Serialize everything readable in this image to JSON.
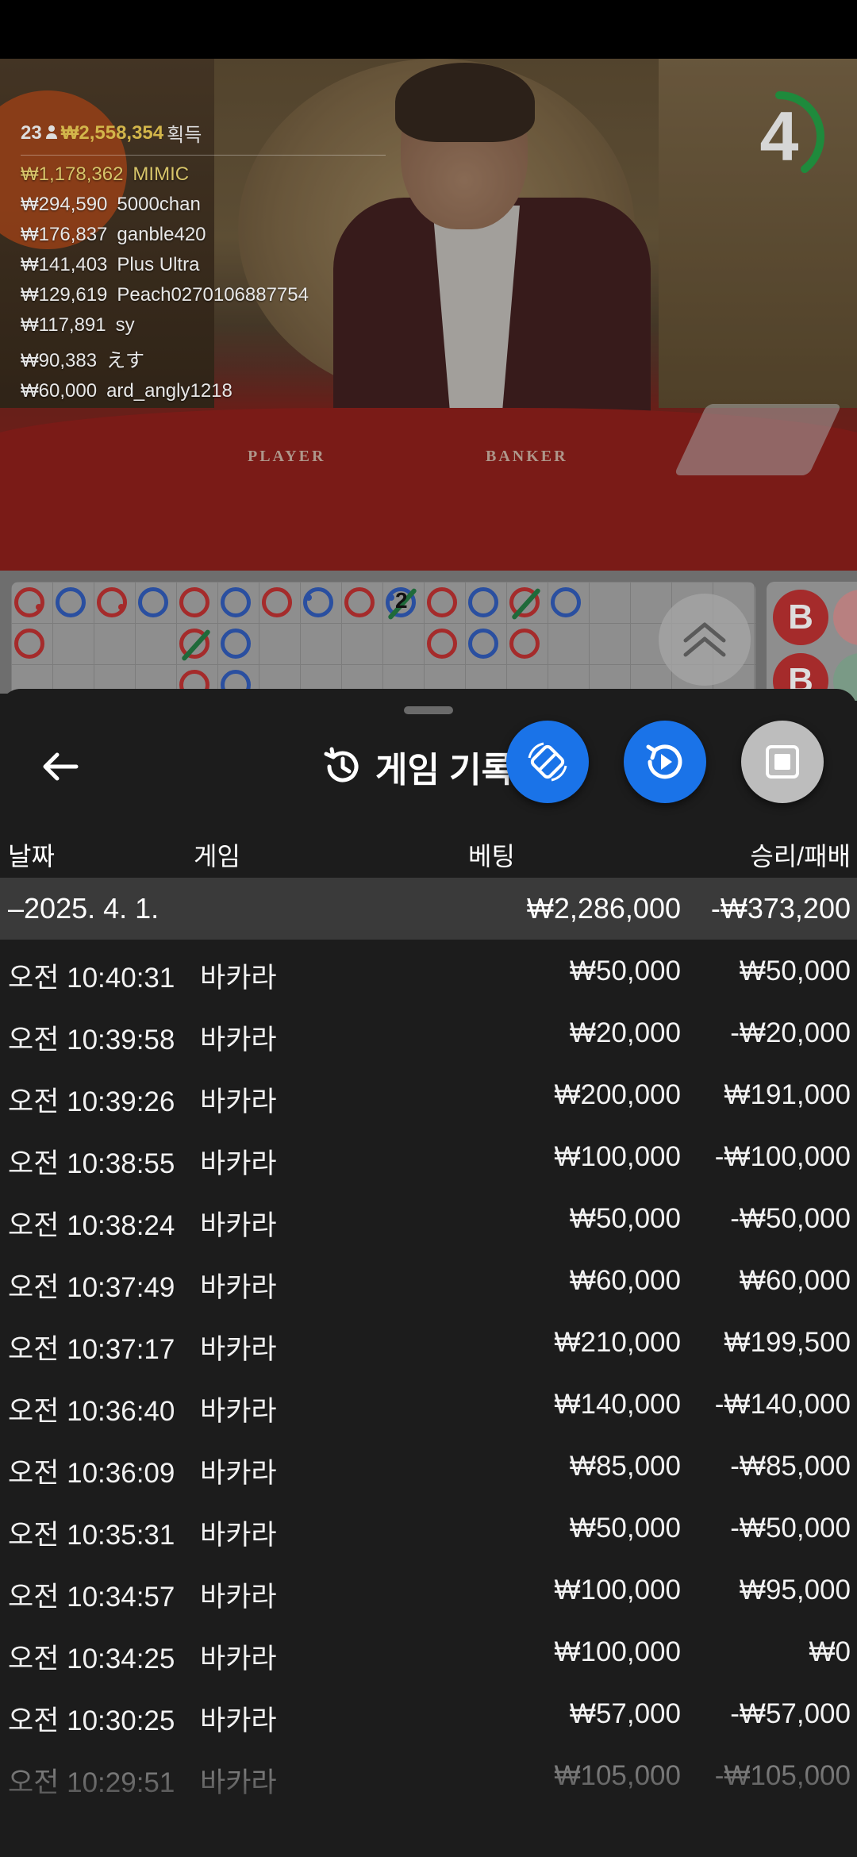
{
  "video": {
    "table_labels": [
      "PLAYER",
      "BANKER"
    ],
    "timer": "4",
    "winners_total": {
      "count": "23",
      "amount": "₩2,558,354",
      "suffix": "획득"
    },
    "winners": [
      {
        "amount": "₩1,178,362",
        "name": "MIMIC"
      },
      {
        "amount": "₩294,590",
        "name": "5000chan"
      },
      {
        "amount": "₩176,837",
        "name": "ganble420"
      },
      {
        "amount": "₩141,403",
        "name": "Plus Ultra"
      },
      {
        "amount": "₩129,619",
        "name": "Peach0270106887754"
      },
      {
        "amount": "₩117,891",
        "name": "sy"
      },
      {
        "amount": "₩90,383",
        "name": "えす"
      },
      {
        "amount": "₩60,000",
        "name": "ard_angly1218"
      }
    ]
  },
  "roadmap": {
    "number_label": "2",
    "bigroad_chips": [
      "B",
      "B"
    ]
  },
  "sheet": {
    "title": "게임 기록",
    "columns": {
      "date": "날짜",
      "game": "게임",
      "bet": "베팅",
      "winloss": "승리/패배"
    },
    "summary": {
      "date": "–2025. 4. 1.",
      "bet": "₩2,286,000",
      "winloss": "-₩373,200"
    },
    "rows": [
      {
        "time": "오전 10:40:31",
        "game": "바카라",
        "bet": "₩50,000",
        "winloss": "₩50,000"
      },
      {
        "time": "오전 10:39:58",
        "game": "바카라",
        "bet": "₩20,000",
        "winloss": "-₩20,000"
      },
      {
        "time": "오전 10:39:26",
        "game": "바카라",
        "bet": "₩200,000",
        "winloss": "₩191,000"
      },
      {
        "time": "오전 10:38:55",
        "game": "바카라",
        "bet": "₩100,000",
        "winloss": "-₩100,000"
      },
      {
        "time": "오전 10:38:24",
        "game": "바카라",
        "bet": "₩50,000",
        "winloss": "-₩50,000"
      },
      {
        "time": "오전 10:37:49",
        "game": "바카라",
        "bet": "₩60,000",
        "winloss": "₩60,000"
      },
      {
        "time": "오전 10:37:17",
        "game": "바카라",
        "bet": "₩210,000",
        "winloss": "₩199,500"
      },
      {
        "time": "오전 10:36:40",
        "game": "바카라",
        "bet": "₩140,000",
        "winloss": "-₩140,000"
      },
      {
        "time": "오전 10:36:09",
        "game": "바카라",
        "bet": "₩85,000",
        "winloss": "-₩85,000"
      },
      {
        "time": "오전 10:35:31",
        "game": "바카라",
        "bet": "₩50,000",
        "winloss": "-₩50,000"
      },
      {
        "time": "오전 10:34:57",
        "game": "바카라",
        "bet": "₩100,000",
        "winloss": "₩95,000"
      },
      {
        "time": "오전 10:34:25",
        "game": "바카라",
        "bet": "₩100,000",
        "winloss": "₩0"
      },
      {
        "time": "오전 10:30:25",
        "game": "바카라",
        "bet": "₩57,000",
        "winloss": "-₩57,000"
      },
      {
        "time": "오전 10:29:51",
        "game": "바카라",
        "bet": "₩105,000",
        "winloss": "-₩105,000"
      }
    ]
  },
  "colors": {
    "fab_blue": "#1a73e8",
    "banker_red": "#a52b2b",
    "player_blue": "#2a4fa0",
    "sheet_bg": "#1c1c1c"
  }
}
